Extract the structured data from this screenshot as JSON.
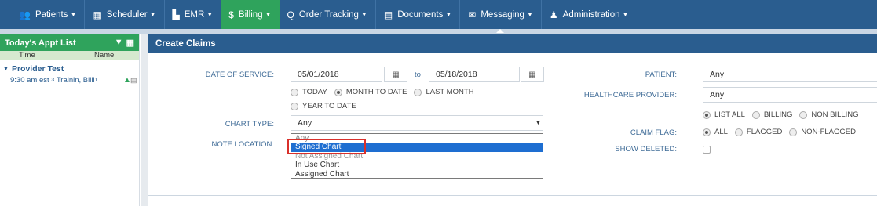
{
  "nav": {
    "items": [
      {
        "label": "Patients",
        "icon": "patients-icon",
        "glyph": "👥"
      },
      {
        "label": "Scheduler",
        "icon": "calendar-icon",
        "glyph": "▦"
      },
      {
        "label": "EMR",
        "icon": "emr-icon",
        "glyph": "▙"
      },
      {
        "label": "Billing",
        "icon": "dollar-icon",
        "glyph": "$"
      },
      {
        "label": "Order Tracking",
        "icon": "search-icon",
        "glyph": "Q"
      },
      {
        "label": "Documents",
        "icon": "document-icon",
        "glyph": "▤"
      },
      {
        "label": "Messaging",
        "icon": "envelope-icon",
        "glyph": "✉"
      },
      {
        "label": "Administration",
        "icon": "user-icon",
        "glyph": "♟"
      }
    ],
    "active": "Billing",
    "colors": {
      "bar": "#2a5d8f",
      "active": "#2fa35c"
    }
  },
  "appt_list": {
    "title": "Today's Appt List",
    "col_time": "Time",
    "col_name": "Name",
    "group": "Provider Test",
    "appt": {
      "time": "9:30 am",
      "type": "est",
      "sup1": "3",
      "name": "Trainin, Billi",
      "sup2": "1"
    }
  },
  "create_claims": {
    "title": "Create Claims",
    "date_of_service_label": "DATE OF SERVICE:",
    "date_from": "05/01/2018",
    "to_label": "to",
    "date_to": "05/18/2018",
    "date_range_options": [
      "TODAY",
      "MONTH TO DATE",
      "LAST MONTH",
      "YEAR TO DATE"
    ],
    "date_range_selected": "MONTH TO DATE",
    "chart_type_label": "CHART TYPE:",
    "chart_type_value": "Any",
    "chart_type_options": [
      "Any",
      "Signed Chart",
      "Not Assigned Chart",
      "In Use Chart",
      "Assigned Chart"
    ],
    "chart_type_highlighted": "Signed Chart",
    "note_location_label": "NOTE LOCATION:",
    "patient_label": "PATIENT:",
    "patient_value": "Any",
    "provider_label": "HEALTHCARE PROVIDER:",
    "provider_value": "Any",
    "provider_filter_options": [
      "LIST ALL",
      "BILLING",
      "NON BILLING"
    ],
    "provider_filter_selected": "LIST ALL",
    "claim_flag_label": "CLAIM FLAG:",
    "claim_flag_options": [
      "ALL",
      "FLAGGED",
      "NON-FLAGGED"
    ],
    "claim_flag_selected": "ALL",
    "show_deleted_label": "SHOW DELETED:"
  }
}
